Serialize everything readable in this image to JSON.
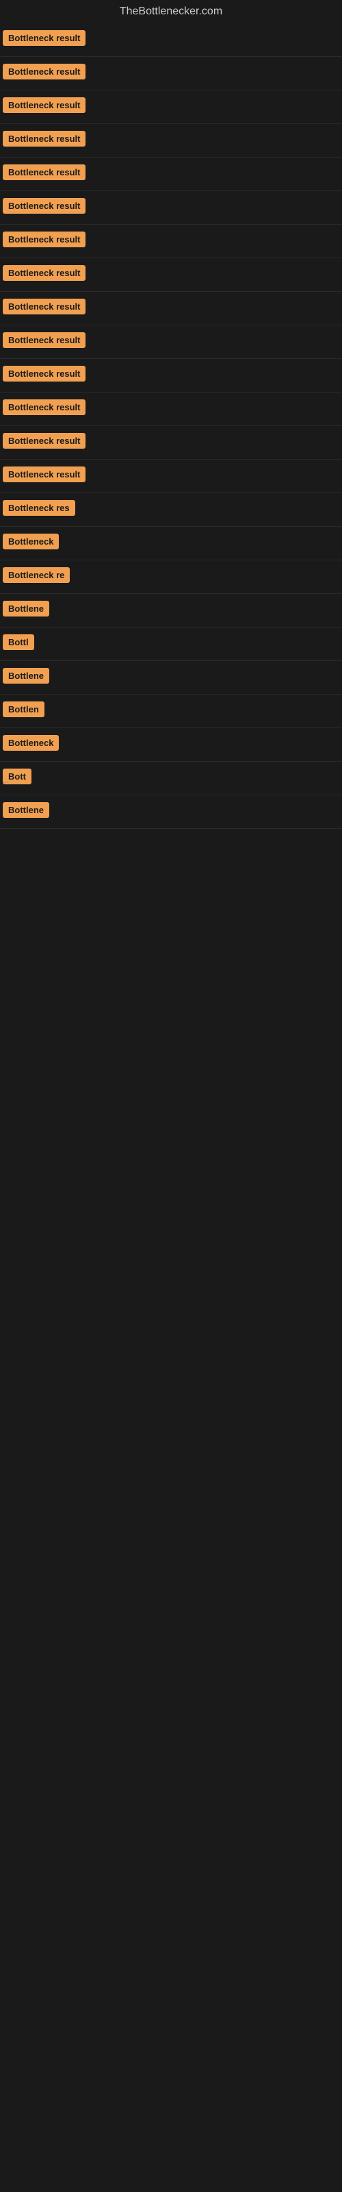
{
  "site": {
    "title": "TheBottlenecker.com"
  },
  "badges": [
    {
      "label": "Bottleneck result",
      "width": 130
    },
    {
      "label": "Bottleneck result",
      "width": 130
    },
    {
      "label": "Bottleneck result",
      "width": 130
    },
    {
      "label": "Bottleneck result",
      "width": 130
    },
    {
      "label": "Bottleneck result",
      "width": 130
    },
    {
      "label": "Bottleneck result",
      "width": 130
    },
    {
      "label": "Bottleneck result",
      "width": 130
    },
    {
      "label": "Bottleneck result",
      "width": 130
    },
    {
      "label": "Bottleneck result",
      "width": 130
    },
    {
      "label": "Bottleneck result",
      "width": 130
    },
    {
      "label": "Bottleneck result",
      "width": 130
    },
    {
      "label": "Bottleneck result",
      "width": 130
    },
    {
      "label": "Bottleneck result",
      "width": 130
    },
    {
      "label": "Bottleneck result",
      "width": 130
    },
    {
      "label": "Bottleneck res",
      "width": 110
    },
    {
      "label": "Bottleneck",
      "width": 82
    },
    {
      "label": "Bottleneck re",
      "width": 98
    },
    {
      "label": "Bottlene",
      "width": 72
    },
    {
      "label": "Bottl",
      "width": 52
    },
    {
      "label": "Bottlene",
      "width": 72
    },
    {
      "label": "Bottlen",
      "width": 65
    },
    {
      "label": "Bottleneck",
      "width": 82
    },
    {
      "label": "Bott",
      "width": 46
    },
    {
      "label": "Bottlene",
      "width": 72
    }
  ],
  "ellipsis": "..."
}
